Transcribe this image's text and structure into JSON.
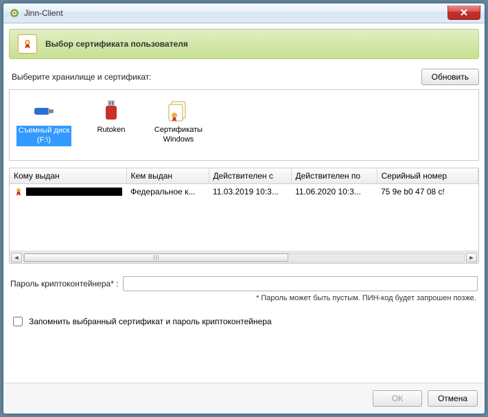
{
  "window": {
    "title": "Jinn-Client"
  },
  "banner": {
    "title": "Выбор сертификата пользователя"
  },
  "storage": {
    "label": "Выберите хранилище и сертификат:",
    "refresh": "Обновить",
    "items": [
      {
        "label": "Съемный диск (F:\\)",
        "selected": true
      },
      {
        "label": "Rutoken",
        "selected": false
      },
      {
        "label": "Сертификаты Windows",
        "selected": false
      }
    ]
  },
  "table": {
    "columns": [
      "Кому выдан",
      "Кем выдан",
      "Действителен с",
      "Действителен по",
      "Серийный номер"
    ],
    "rows": [
      {
        "issued_to": "████████████",
        "issued_by": "Федеральное к...",
        "valid_from": "11.03.2019 10:3...",
        "valid_to": "11.06.2020 10:3...",
        "serial": "75 9e b0 47 08 c!"
      }
    ]
  },
  "password": {
    "label": "Пароль криптоконтейнера* :",
    "value": "",
    "hint": "* Пароль может быть пустым. ПИН-код будет запрошен позже."
  },
  "remember": {
    "label": "Запомнить выбранный сертификат и пароль криптоконтейнера",
    "checked": false
  },
  "buttons": {
    "ok": "ОК",
    "cancel": "Отмена"
  }
}
